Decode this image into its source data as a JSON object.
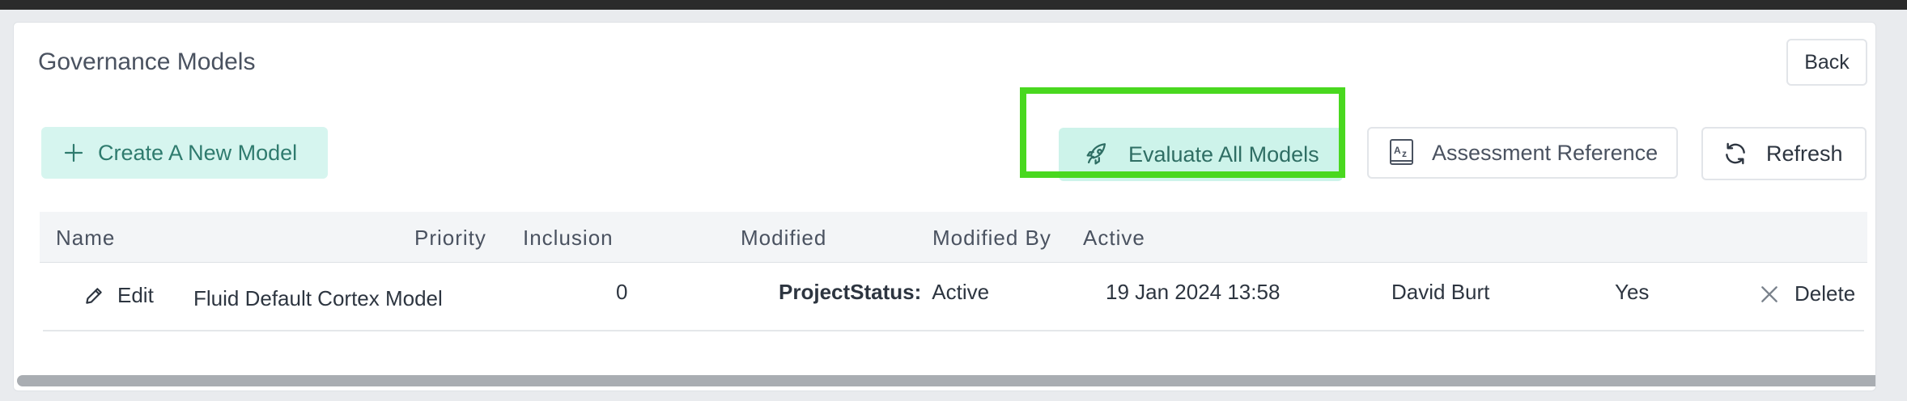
{
  "header": {
    "title": "Governance Models",
    "back_label": "Back"
  },
  "toolbar": {
    "create_label": "Create A New Model",
    "evaluate_label": "Evaluate All Models",
    "assessment_label": "Assessment Reference",
    "refresh_label": "Refresh"
  },
  "table": {
    "columns": {
      "name": "Name",
      "priority": "Priority",
      "inclusion": "Inclusion",
      "modified": "Modified",
      "modified_by": "Modified By",
      "active": "Active"
    },
    "rows": [
      {
        "edit_label": "Edit",
        "name": "Fluid Default Cortex Model",
        "priority": "0",
        "inclusion_key": "ProjectStatus:",
        "inclusion_value": "Active",
        "modified": "19 Jan 2024 13:58",
        "modified_by": "David Burt",
        "active": "Yes",
        "delete_label": "Delete"
      }
    ]
  },
  "colors": {
    "accent_bg": "#d6f5ef",
    "accent_text": "#2f7b6e",
    "highlight": "#49d81f"
  },
  "icons": [
    "plus-icon",
    "rocket-icon",
    "az-book-icon",
    "refresh-icon",
    "pencil-icon",
    "close-icon"
  ]
}
